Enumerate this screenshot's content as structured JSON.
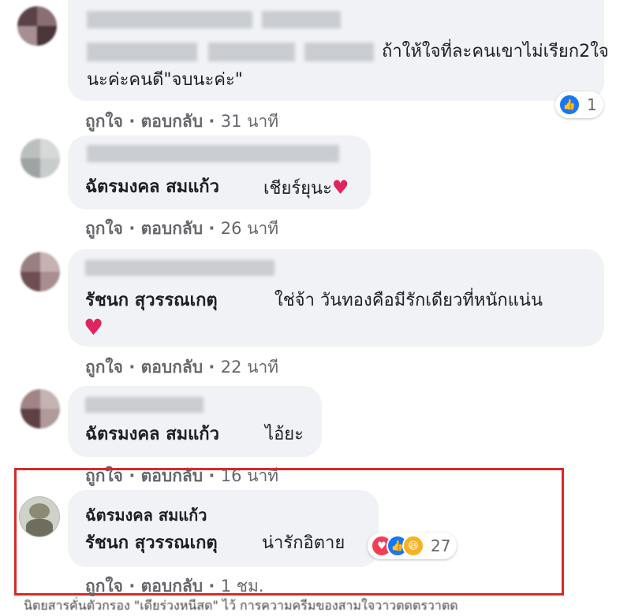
{
  "comments": [
    {
      "text": "ถ้าให้ใจที่ละคนเขาไม่เรียก2ใจ",
      "text2": "นะค่ะคนดี\"จบนะค่ะ\"",
      "like": "ถูกใจ",
      "reply": "ตอบกลับ",
      "time": "31 นาที",
      "reaction_count": "1"
    },
    {
      "mention": "ฉัตรมงคล สมแก้ว",
      "text": "เชียร์ยุนะ",
      "like": "ถูกใจ",
      "reply": "ตอบกลับ",
      "time": "26 นาที"
    },
    {
      "mention": "รัชนก สุวรรณเกตุ",
      "text": "ใช่จ้า วันทองคือมีรักเดียวที่หนักแน่น",
      "like": "ถูกใจ",
      "reply": "ตอบกลับ",
      "time": "22 นาที"
    },
    {
      "mention": "ฉัตรมงคล สมแก้ว",
      "text": "ไอ้ยะ",
      "like": "ถูกใจ",
      "reply": "ตอบกลับ",
      "time": "16 นาที"
    },
    {
      "author": "ฉัตรมงคล สมแก้ว",
      "mention": "รัชนก สุวรรณเกตุ",
      "text": "น่ารักอิตาย",
      "like": "ถูกใจ",
      "reply": "ตอบกลับ",
      "time": "1 ชม.",
      "reaction_count": "27"
    }
  ],
  "dot": "·",
  "caption": "นิตยสารคั่นตัวกรอง \"เดียร่วงหนีสด\" ไว้ การความครีมของสามใจวาวตดตรวาตด",
  "colors": {
    "highlight": "#d62a2a",
    "bubble": "#f0f2f5",
    "like_blue": "#1877f2",
    "love_red": "#f33e58",
    "haha_yellow": "#f7b125"
  }
}
